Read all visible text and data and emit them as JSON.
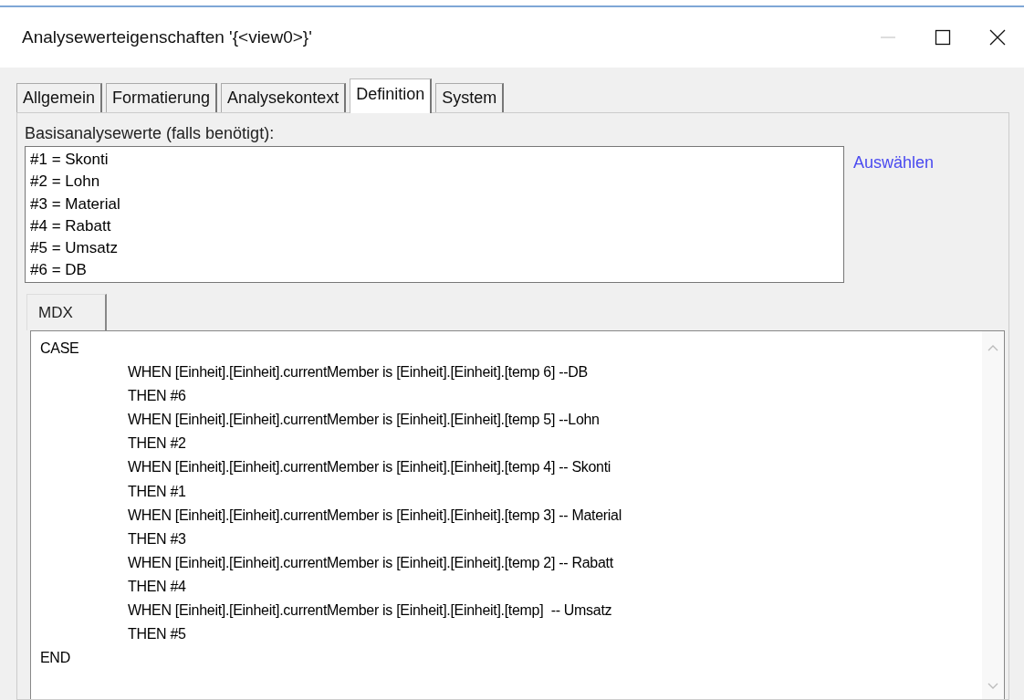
{
  "window": {
    "title": "Analysewerteigenschaften '{<view0>}'"
  },
  "tabs": [
    {
      "label": "Allgemein",
      "selected": false
    },
    {
      "label": "Formatierung",
      "selected": false
    },
    {
      "label": "Analysekontext",
      "selected": false
    },
    {
      "label": "Definition",
      "selected": true
    },
    {
      "label": "System",
      "selected": false
    }
  ],
  "base_values": {
    "label": "Basisanalysewerte (falls benötigt):",
    "items": [
      "#1 = Skonti",
      "#2 = Lohn",
      "#3 = Material",
      "#4 = Rabatt",
      "#5 = Umsatz",
      "#6 = DB"
    ],
    "link": "Auswählen"
  },
  "editor_tabs": [
    {
      "label": "MDX"
    }
  ],
  "code_lines": [
    {
      "text": "CASE",
      "indent": false
    },
    {
      "text": "WHEN [Einheit].[Einheit].currentMember is [Einheit].[Einheit].[temp 6] --DB",
      "indent": true
    },
    {
      "text": "THEN #6",
      "indent": true
    },
    {
      "text": "WHEN [Einheit].[Einheit].currentMember is [Einheit].[Einheit].[temp 5] --Lohn",
      "indent": true
    },
    {
      "text": "THEN #2",
      "indent": true
    },
    {
      "text": "WHEN [Einheit].[Einheit].currentMember is [Einheit].[Einheit].[temp 4] -- Skonti",
      "indent": true
    },
    {
      "text": "THEN #1",
      "indent": true
    },
    {
      "text": "WHEN [Einheit].[Einheit].currentMember is [Einheit].[Einheit].[temp 3] -- Material",
      "indent": true
    },
    {
      "text": "THEN #3",
      "indent": true
    },
    {
      "text": "WHEN [Einheit].[Einheit].currentMember is [Einheit].[Einheit].[temp 2] -- Rabatt",
      "indent": true
    },
    {
      "text": "THEN #4",
      "indent": true
    },
    {
      "text": "WHEN [Einheit].[Einheit].currentMember is [Einheit].[Einheit].[temp]  -- Umsatz",
      "indent": true
    },
    {
      "text": "THEN #5",
      "indent": true
    },
    {
      "text": "END",
      "indent": false
    }
  ]
}
